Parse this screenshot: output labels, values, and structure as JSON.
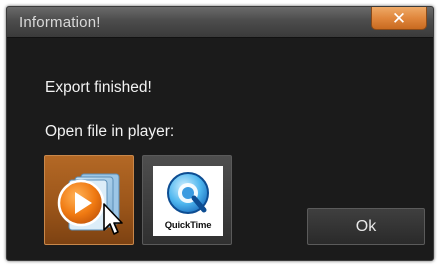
{
  "dialog": {
    "title": "Information!",
    "close_label": "✕",
    "message": "Export finished!",
    "prompt": "Open file in player:",
    "ok_label": "Ok"
  },
  "players": [
    {
      "name": "Windows Media Player",
      "icon": "media-player-play-icon",
      "selected": true
    },
    {
      "name": "QuickTime",
      "icon": "quicktime-icon",
      "label": "QuickTime"
    }
  ],
  "colors": {
    "dialog_bg": "#1b1b1b",
    "accent_orange": "#e0863c",
    "selected_tile": "#9c561a",
    "text": "#f2f2f2"
  }
}
